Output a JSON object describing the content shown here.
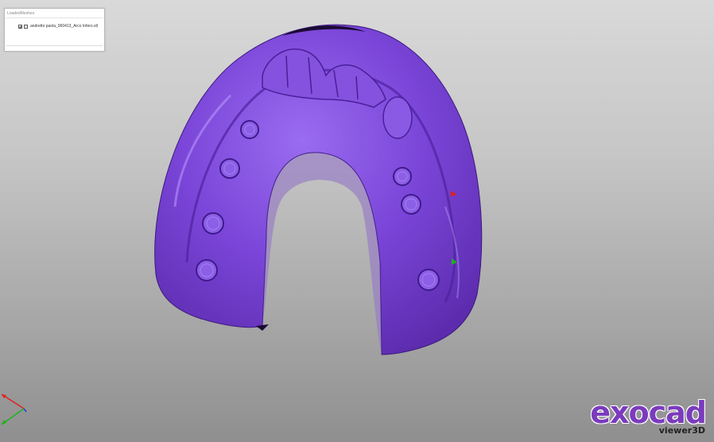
{
  "panel": {
    "title": "LoadedMeshes",
    "meshes": [
      {
        "label": "andretto paola_060413_Arco Infero.stl",
        "checked": true,
        "visible": true
      }
    ]
  },
  "logo": {
    "brand": "exocad",
    "product": "viewer3D",
    "color": "#7b3bbd"
  },
  "model": {
    "color": "#7b42d6",
    "icon": "dental-arch-mesh"
  },
  "axes": {
    "x_color": "#e02020",
    "y_color": "#20b020",
    "z_color": "#2040e0"
  }
}
